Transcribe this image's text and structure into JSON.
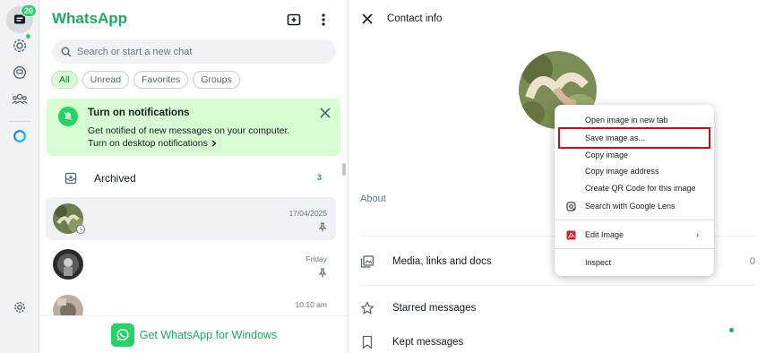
{
  "rail": {
    "chats_badge": "20",
    "items": [
      "chats-icon",
      "status-icon",
      "channels-icon",
      "communities-icon",
      "meta-ai-icon",
      "settings-icon"
    ]
  },
  "sidebar": {
    "title": "WhatsApp",
    "search_placeholder": "Search or start a new chat",
    "filters": [
      "All",
      "Unread",
      "Favorites",
      "Groups"
    ],
    "notification": {
      "title": "Turn on notifications",
      "body": "Get notified of new messages on your computer.",
      "link": "Turn on desktop notifications"
    },
    "archived": {
      "label": "Archived",
      "count": "3"
    },
    "chats": [
      {
        "time": "17/04/2025",
        "pinned": true
      },
      {
        "time": "Friday",
        "pinned": true
      },
      {
        "time": "10:10 am",
        "pinned": false
      }
    ],
    "cta": "Get WhatsApp for Windows"
  },
  "contact_info": {
    "title": "Contact info",
    "about_label": "About",
    "rows": [
      "Media, links and docs",
      "Starred messages",
      "Kept messages"
    ],
    "media_count": "0"
  },
  "context_menu": {
    "items": [
      "Open image in new tab",
      "Save image as...",
      "Copy image",
      "Copy image address",
      "Create QR Code for this image",
      "Search with Google Lens",
      "Edit Image",
      "Inspect"
    ],
    "highlighted": "Save image as..."
  },
  "colors": {
    "brand_green": "#1daa61",
    "accent_green": "#25d366",
    "notification_bg": "#d9fdd3",
    "highlight_red": "#c1121f"
  }
}
